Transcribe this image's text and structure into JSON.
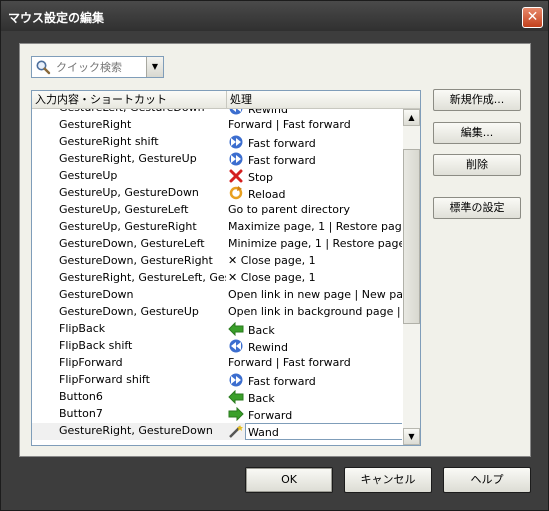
{
  "window": {
    "title": "マウス設定の編集",
    "close_label": "✕"
  },
  "search": {
    "placeholder": "クイック検索",
    "value": ""
  },
  "list": {
    "headers": [
      "入力内容・ショートカット",
      "処理"
    ],
    "rows": [
      {
        "input": "GestureLeft, GestureDown",
        "action": "Rewind",
        "icon": "rewind-icon"
      },
      {
        "input": "GestureRight",
        "action": "Forward | Fast forward",
        "icon": ""
      },
      {
        "input": "GestureRight shift",
        "action": "Fast forward",
        "icon": "fast-forward-icon"
      },
      {
        "input": "GestureRight, GestureUp",
        "action": "Fast forward",
        "icon": "fast-forward-icon"
      },
      {
        "input": "GestureUp",
        "action": "Stop",
        "icon": "stop-icon"
      },
      {
        "input": "GestureUp, GestureDown",
        "action": "Reload",
        "icon": "reload-icon"
      },
      {
        "input": "GestureUp, GestureLeft",
        "action": "Go to parent directory",
        "icon": ""
      },
      {
        "input": "GestureUp, GestureRight",
        "action": "Maximize page, 1 | Restore page,...",
        "icon": ""
      },
      {
        "input": "GestureDown, GestureLeft",
        "action": "Minimize page, 1 | Restore page, 1",
        "icon": ""
      },
      {
        "input": "GestureDown, GestureRight",
        "action": "✕ Close page, 1",
        "icon": ""
      },
      {
        "input": "GestureRight, GestureLeft, Ges...",
        "action": "✕ Close page, 1",
        "icon": ""
      },
      {
        "input": "GestureDown",
        "action": "Open link in new page | New page",
        "icon": ""
      },
      {
        "input": "GestureDown, GestureUp",
        "action": "Open link in background page | ......",
        "icon": ""
      },
      {
        "input": "FlipBack",
        "action": "Back",
        "icon": "back-icon"
      },
      {
        "input": "FlipBack shift",
        "action": "Rewind",
        "icon": "rewind-icon"
      },
      {
        "input": "FlipForward",
        "action": "Forward | Fast forward",
        "icon": ""
      },
      {
        "input": "FlipForward shift",
        "action": "Fast forward",
        "icon": "fast-forward-icon"
      },
      {
        "input": "Button6",
        "action": "Back",
        "icon": "back-icon"
      },
      {
        "input": "Button7",
        "action": "Forward",
        "icon": "forward-icon"
      },
      {
        "input": "GestureRight, GestureDown",
        "action": "Wand",
        "icon": "wand-icon",
        "selected": true
      }
    ]
  },
  "side_buttons": {
    "new": "新規作成...",
    "edit": "編集...",
    "delete": "削除",
    "defaults": "標準の設定"
  },
  "bottom_buttons": {
    "ok": "OK",
    "cancel": "キャンセル",
    "help": "ヘルプ"
  }
}
